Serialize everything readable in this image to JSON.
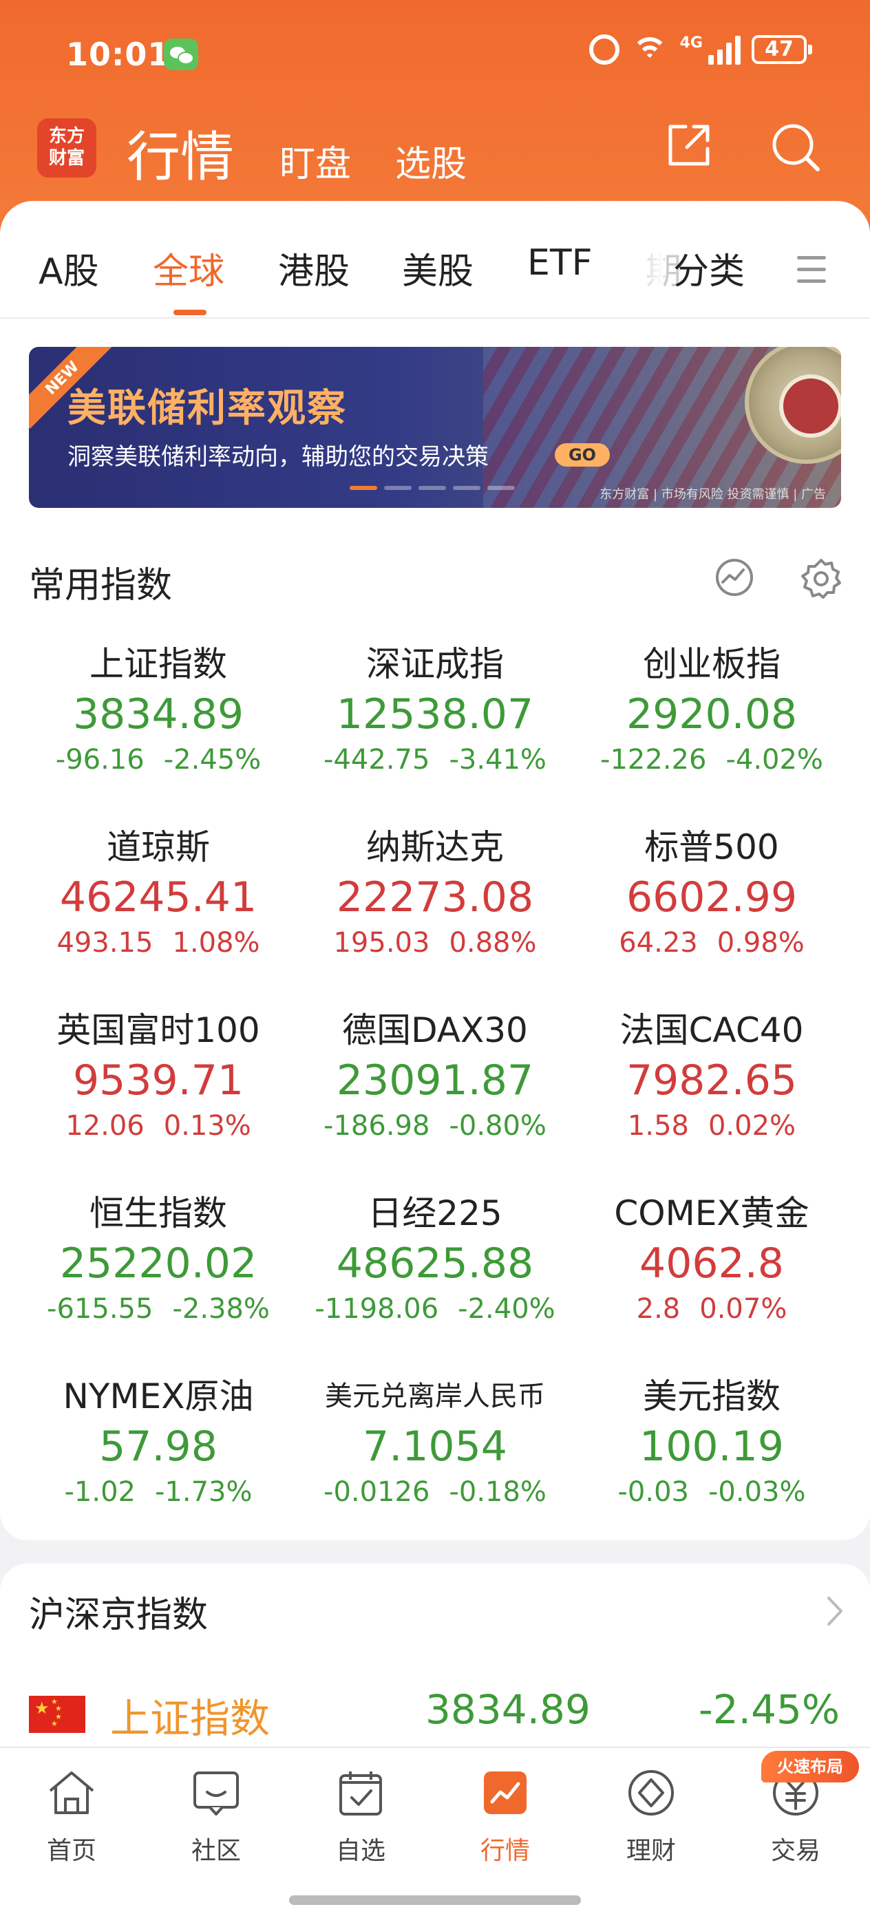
{
  "status_bar": {
    "time": "10:01",
    "network": "4G",
    "battery": "47"
  },
  "header": {
    "logo_line1": "东方",
    "logo_line2": "财富",
    "title": "行情",
    "sub_tabs": [
      "盯盘",
      "选股"
    ]
  },
  "tabs": [
    "A股",
    "全球",
    "港股",
    "美股",
    "ETF",
    "期",
    "分类"
  ],
  "active_tab": "全球",
  "banner": {
    "ribbon": "NEW",
    "title": "美联储利率观察",
    "subtitle": "洞察美联储利率动向，辅助您的交易决策",
    "go": "GO",
    "brand": "东方财富 | 市场有风险 投资需谨慎 | 广告"
  },
  "common_indices": {
    "title": "常用指数",
    "items": [
      {
        "name": "上证指数",
        "price": "3834.89",
        "change": "-96.16",
        "pct": "-2.45%",
        "dir": "down"
      },
      {
        "name": "深证成指",
        "price": "12538.07",
        "change": "-442.75",
        "pct": "-3.41%",
        "dir": "down"
      },
      {
        "name": "创业板指",
        "price": "2920.08",
        "change": "-122.26",
        "pct": "-4.02%",
        "dir": "down"
      },
      {
        "name": "道琼斯",
        "price": "46245.41",
        "change": "493.15",
        "pct": "1.08%",
        "dir": "up"
      },
      {
        "name": "纳斯达克",
        "price": "22273.08",
        "change": "195.03",
        "pct": "0.88%",
        "dir": "up"
      },
      {
        "name": "标普500",
        "price": "6602.99",
        "change": "64.23",
        "pct": "0.98%",
        "dir": "up"
      },
      {
        "name": "英国富时100",
        "price": "9539.71",
        "change": "12.06",
        "pct": "0.13%",
        "dir": "up"
      },
      {
        "name": "德国DAX30",
        "price": "23091.87",
        "change": "-186.98",
        "pct": "-0.80%",
        "dir": "down"
      },
      {
        "name": "法国CAC40",
        "price": "7982.65",
        "change": "1.58",
        "pct": "0.02%",
        "dir": "up"
      },
      {
        "name": "恒生指数",
        "price": "25220.02",
        "change": "-615.55",
        "pct": "-2.38%",
        "dir": "down"
      },
      {
        "name": "日经225",
        "price": "48625.88",
        "change": "-1198.06",
        "pct": "-2.40%",
        "dir": "down"
      },
      {
        "name": "COMEX黄金",
        "price": "4062.8",
        "change": "2.8",
        "pct": "0.07%",
        "dir": "up"
      },
      {
        "name": "NYMEX原油",
        "price": "57.98",
        "change": "-1.02",
        "pct": "-1.73%",
        "dir": "down"
      },
      {
        "name": "美元兑离岸人民币",
        "price": "7.1054",
        "change": "-0.0126",
        "pct": "-0.18%",
        "dir": "down"
      },
      {
        "name": "美元指数",
        "price": "100.19",
        "change": "-0.03",
        "pct": "-0.03%",
        "dir": "down"
      }
    ]
  },
  "hs_section": {
    "title": "沪深京指数",
    "rows": [
      {
        "name": "上证指数",
        "price": "3834.89",
        "pct": "-2.45%"
      }
    ]
  },
  "bottom_nav": {
    "items": [
      "首页",
      "社区",
      "自选",
      "行情",
      "理财",
      "交易"
    ],
    "active": "行情",
    "badge": "火速布局"
  },
  "colors": {
    "accent": "#f0682c",
    "up": "#d23c3c",
    "down": "#3e9a38",
    "header": "#f06a2e"
  }
}
